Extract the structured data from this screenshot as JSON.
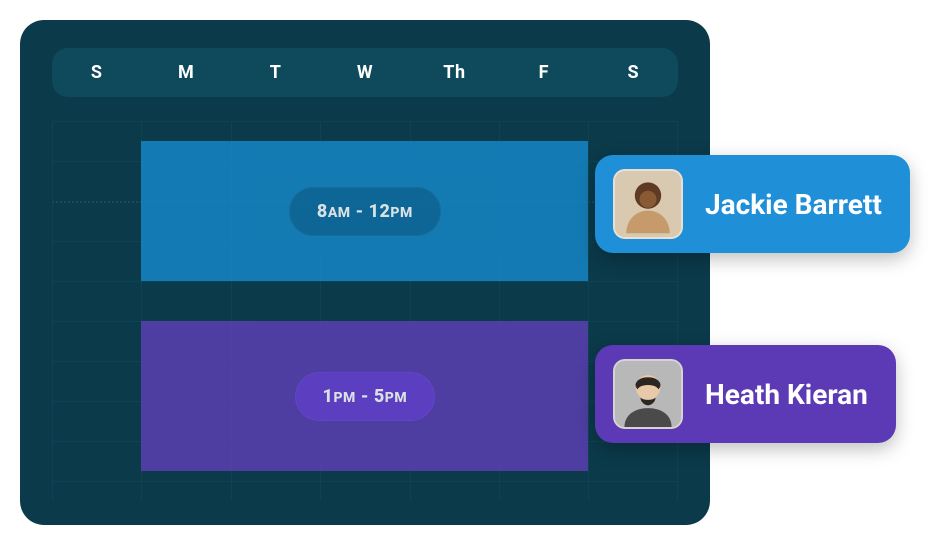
{
  "days": [
    "S",
    "M",
    "T",
    "W",
    "Th",
    "F",
    "S"
  ],
  "shifts": [
    {
      "label_start": "8",
      "label_start_ampm": "AM",
      "label_end": "12",
      "label_end_ampm": "PM",
      "color": "blue"
    },
    {
      "label_start": "1",
      "label_start_ampm": "PM",
      "label_end": "5",
      "label_end_ampm": "PM",
      "color": "purple"
    }
  ],
  "people": [
    {
      "name": "Jackie Barrett",
      "color": "blue"
    },
    {
      "name": "Heath Kieran",
      "color": "purple"
    }
  ]
}
